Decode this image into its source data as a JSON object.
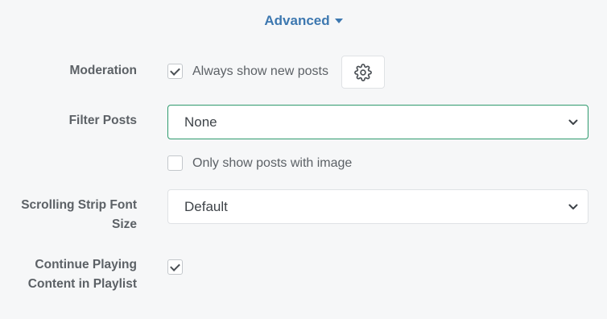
{
  "advanced": {
    "label": "Advanced"
  },
  "moderation": {
    "label": "Moderation",
    "checkbox_label": "Always show new posts",
    "checked": true,
    "settings_icon": "gear-icon"
  },
  "filter_posts": {
    "label": "Filter Posts",
    "selected": "None",
    "only_image_label": "Only show posts with image",
    "only_image_checked": false
  },
  "font_size": {
    "label_line1": "Scrolling Strip Font",
    "label_line2": "Size",
    "selected": "Default"
  },
  "continue_playing": {
    "label_line1": "Continue Playing",
    "label_line2": "Content in Playlist",
    "checked": true
  },
  "colors": {
    "accent_link": "#3d78b0",
    "focus_border": "#2f9a6e",
    "label_text": "#5c6166",
    "background": "#f6f7f8"
  }
}
